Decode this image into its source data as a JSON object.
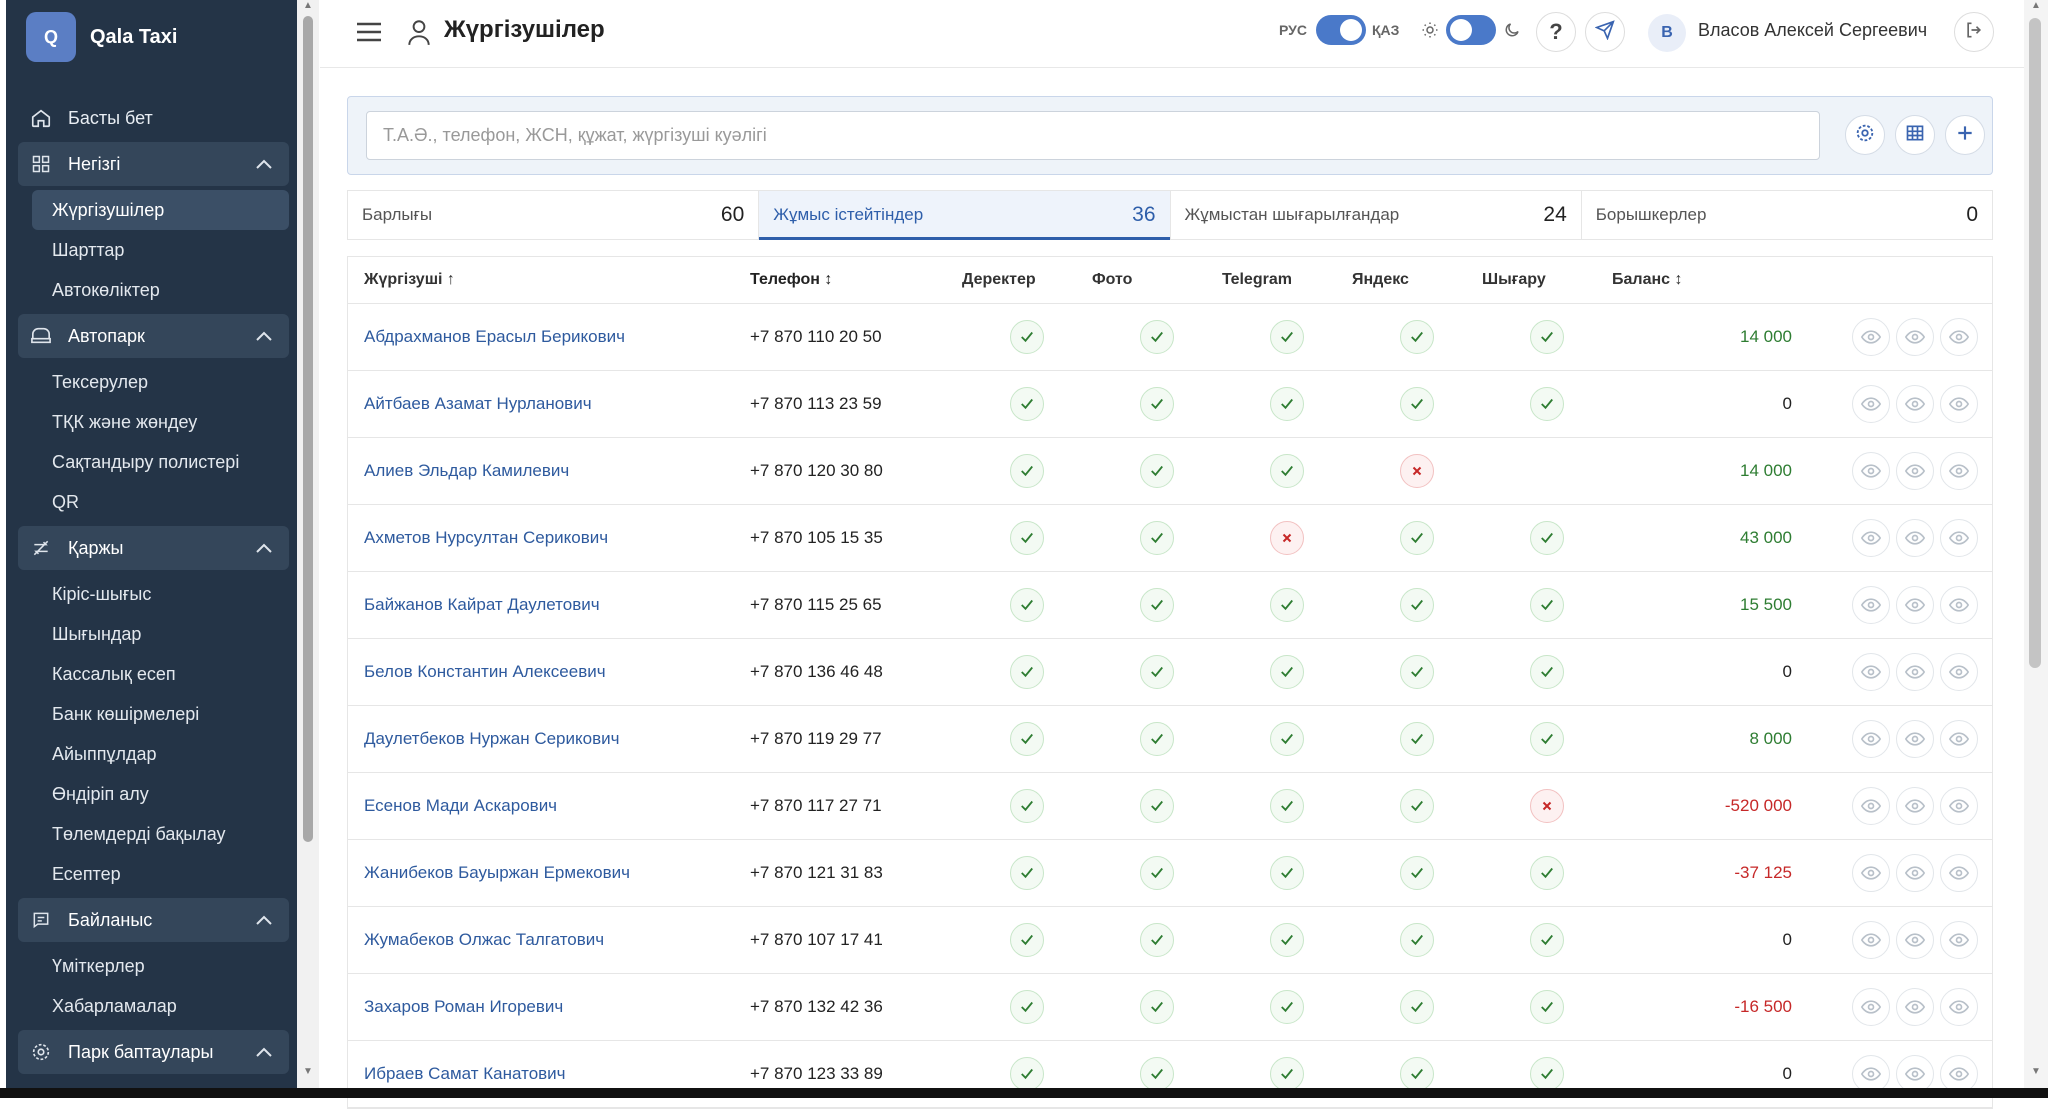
{
  "app": {
    "logo_letter": "Q",
    "name": "Qala Taxi"
  },
  "nav": {
    "home": "Басты бет",
    "groups": [
      {
        "label": "Негізгі",
        "items": [
          "Жүргізушілер",
          "Шарттар",
          "Автокөліктер"
        ]
      },
      {
        "label": "Автопарк",
        "items": [
          "Тексерулер",
          "ТҚК және жөндеу",
          "Сақтандыру полистері",
          "QR"
        ]
      },
      {
        "label": "Қаржы",
        "items": [
          "Кіріс-шығыс",
          "Шығындар",
          "Кассалық есеп",
          "Банк көшірмелері",
          "Айыппұлдар",
          "Өндіріп алу",
          "Төлемдерді бақылау",
          "Есептер"
        ]
      },
      {
        "label": "Байланыс",
        "items": [
          "Үміткерлер",
          "Хабарламалар"
        ]
      },
      {
        "label": "Парк баптаулары",
        "items": []
      }
    ],
    "active_item": "Жүргізушілер"
  },
  "header": {
    "title": "Жүргізушілер",
    "lang_left": "РУС",
    "lang_right": "ҚАЗ",
    "user_initial": "В",
    "user_name": "Власов Алексей Сергеевич"
  },
  "search": {
    "placeholder": "Т.А.Ә., телефон, ЖСН, құжат, жүргізуші куәлігі"
  },
  "tabs": [
    {
      "label": "Барлығы",
      "count": "60"
    },
    {
      "label": "Жұмыс істейтіндер",
      "count": "36"
    },
    {
      "label": "Жұмыстан шығарылғандар",
      "count": "24"
    },
    {
      "label": "Борышкерлер",
      "count": "0"
    }
  ],
  "table": {
    "columns": [
      "Жүргізуші ↑",
      "Телефон ↕",
      "Деректер",
      "Фото",
      "Telegram",
      "Яндекс",
      "Шығару",
      "Баланс ↕"
    ],
    "rows": [
      {
        "name": "Абдрахманов Ерасыл Берикович",
        "phone": "+7 870 110 20 50",
        "status": [
          "ok",
          "ok",
          "ok",
          "ok",
          "ok"
        ],
        "balance": "14 000",
        "tone": "pos"
      },
      {
        "name": "Айтбаев Азамат Нурланович",
        "phone": "+7 870 113 23 59",
        "status": [
          "ok",
          "ok",
          "ok",
          "ok",
          "ok"
        ],
        "balance": "0",
        "tone": "zero"
      },
      {
        "name": "Алиев Эльдар Камилевич",
        "phone": "+7 870 120 30 80",
        "status": [
          "ok",
          "ok",
          "ok",
          "bad",
          "none"
        ],
        "balance": "14 000",
        "tone": "pos"
      },
      {
        "name": "Ахметов Нурсултан Серикович",
        "phone": "+7 870 105 15 35",
        "status": [
          "ok",
          "ok",
          "bad",
          "ok",
          "ok"
        ],
        "balance": "43 000",
        "tone": "pos"
      },
      {
        "name": "Байжанов Кайрат Даулетович",
        "phone": "+7 870 115 25 65",
        "status": [
          "ok",
          "ok",
          "ok",
          "ok",
          "ok"
        ],
        "balance": "15 500",
        "tone": "pos"
      },
      {
        "name": "Белов Константин Алексеевич",
        "phone": "+7 870 136 46 48",
        "status": [
          "ok",
          "ok",
          "ok",
          "ok",
          "ok"
        ],
        "balance": "0",
        "tone": "zero"
      },
      {
        "name": "Даулетбеков Нуржан Серикович",
        "phone": "+7 870 119 29 77",
        "status": [
          "ok",
          "ok",
          "ok",
          "ok",
          "ok"
        ],
        "balance": "8 000",
        "tone": "pos"
      },
      {
        "name": "Есенов Мади Аскарович",
        "phone": "+7 870 117 27 71",
        "status": [
          "ok",
          "ok",
          "ok",
          "ok",
          "bad"
        ],
        "balance": "-520 000",
        "tone": "neg"
      },
      {
        "name": "Жанибеков Бауыржан Ермекович",
        "phone": "+7 870 121 31 83",
        "status": [
          "ok",
          "ok",
          "ok",
          "ok",
          "ok"
        ],
        "balance": "-37 125",
        "tone": "neg"
      },
      {
        "name": "Жумабеков Олжас Талгатович",
        "phone": "+7 870 107 17 41",
        "status": [
          "ok",
          "ok",
          "ok",
          "ok",
          "ok"
        ],
        "balance": "0",
        "tone": "zero"
      },
      {
        "name": "Захаров Роман Игоревич",
        "phone": "+7 870 132 42 36",
        "status": [
          "ok",
          "ok",
          "ok",
          "ok",
          "ok"
        ],
        "balance": "-16 500",
        "tone": "neg"
      },
      {
        "name": "Ибраев Самат Канатович",
        "phone": "+7 870 123 33 89",
        "status": [
          "ok",
          "ok",
          "ok",
          "ok",
          "ok"
        ],
        "balance": "0",
        "tone": "zero"
      }
    ]
  },
  "colors": {
    "sidebar": "#243447",
    "accent": "#2e5eaa",
    "positive": "#2e7d32",
    "negative": "#c62828"
  }
}
